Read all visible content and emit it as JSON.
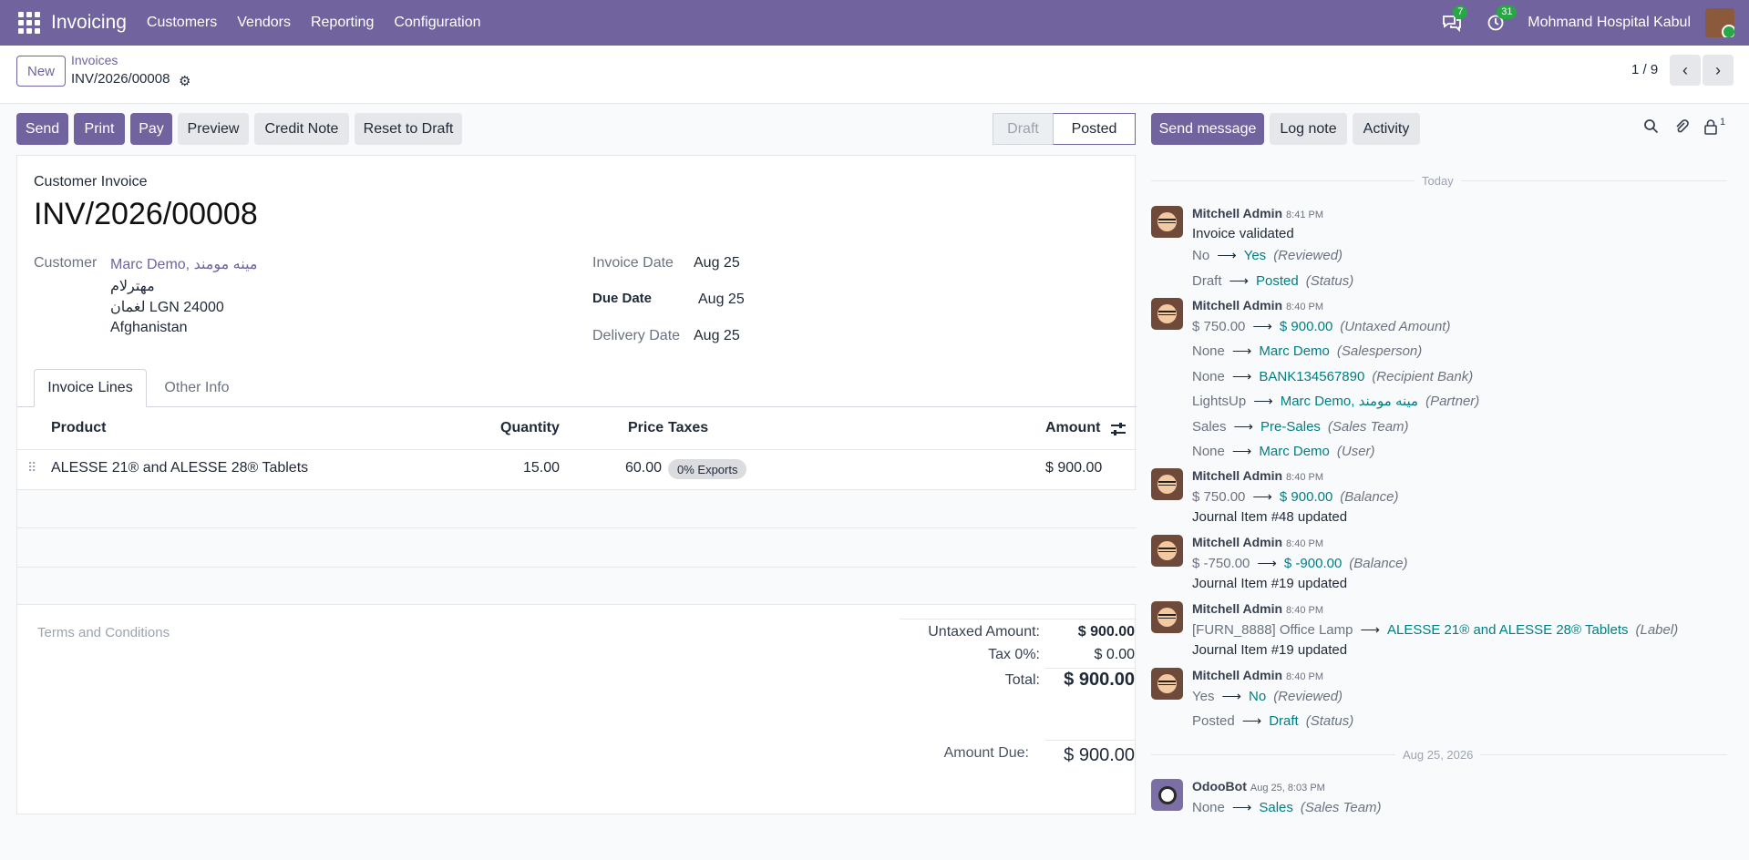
{
  "nav": {
    "app": "Invoicing",
    "menus": [
      "Customers",
      "Vendors",
      "Reporting",
      "Configuration"
    ],
    "messages_badge": "7",
    "activities_badge": "31",
    "company": "Mohmand Hospital Kabul"
  },
  "control": {
    "new_label": "New",
    "breadcrumb_parent": "Invoices",
    "breadcrumb_current": "INV/2026/00008",
    "pager": "1 / 9"
  },
  "actions": {
    "send": "Send",
    "print": "Print",
    "pay": "Pay",
    "preview": "Preview",
    "credit_note": "Credit Note",
    "reset": "Reset to Draft",
    "status_draft": "Draft",
    "status_posted": "Posted"
  },
  "invoice": {
    "type": "Customer Invoice",
    "number": "INV/2026/00008",
    "customer_label": "Customer",
    "customer_name": "Marc Demo, مينه مومند",
    "address_line1": "مهترلام",
    "address_line2": "لغمان LGN 24000",
    "address_line3": "Afghanistan",
    "invoice_date_label": "Invoice Date",
    "invoice_date": "Aug 25",
    "due_date_label": "Due Date",
    "due_date": "Aug 25",
    "delivery_date_label": "Delivery Date",
    "delivery_date": "Aug 25",
    "tabs": [
      "Invoice Lines",
      "Other Info"
    ],
    "columns": {
      "product": "Product",
      "quantity": "Quantity",
      "price": "Price",
      "taxes": "Taxes",
      "amount": "Amount"
    },
    "line": {
      "product": "ALESSE 21® and ALESSE 28® Tablets",
      "quantity": "15.00",
      "price": "60.00",
      "tax": "0% Exports",
      "amount": "$ 900.00"
    },
    "terms_placeholder": "Terms and Conditions",
    "totals": {
      "untaxed_label": "Untaxed Amount:",
      "untaxed": "$ 900.00",
      "tax_label": "Tax 0%:",
      "tax": "$ 0.00",
      "total_label": "Total:",
      "total": "$ 900.00",
      "due_label": "Amount Due:",
      "due": "$ 900.00"
    }
  },
  "chatter": {
    "send_message": "Send message",
    "log_note": "Log note",
    "activity": "Activity",
    "followers_count": "1",
    "today": "Today",
    "date_sep": "Aug 25, 2026",
    "messages": [
      {
        "author": "Mitchell Admin",
        "time": "8:41 PM",
        "body": "Invoice validated",
        "changes": [
          {
            "old": "No",
            "new": "Yes",
            "field": "(Reviewed)"
          },
          {
            "old": "Draft",
            "new": "Posted",
            "field": "(Status)"
          }
        ]
      },
      {
        "author": "Mitchell Admin",
        "time": "8:40 PM",
        "changes": [
          {
            "old": "$ 750.00",
            "new": "$ 900.00",
            "field": "(Untaxed Amount)"
          },
          {
            "old": "None",
            "new": "Marc Demo",
            "field": "(Salesperson)"
          },
          {
            "old": "None",
            "new": "BANK134567890",
            "field": "(Recipient Bank)"
          },
          {
            "old": "LightsUp",
            "new": "Marc Demo, مينه مومند",
            "field": "(Partner)"
          },
          {
            "old": "Sales",
            "new": "Pre-Sales",
            "field": "(Sales Team)"
          },
          {
            "old": "None",
            "new": "Marc Demo",
            "field": "(User)"
          }
        ]
      },
      {
        "author": "Mitchell Admin",
        "time": "8:40 PM",
        "changes": [
          {
            "old": "$ 750.00",
            "new": "$ 900.00",
            "field": "(Balance)"
          }
        ],
        "footer": "Journal Item #48 updated"
      },
      {
        "author": "Mitchell Admin",
        "time": "8:40 PM",
        "changes": [
          {
            "old": "$ -750.00",
            "new": "$ -900.00",
            "field": "(Balance)"
          }
        ],
        "footer": "Journal Item #19 updated"
      },
      {
        "author": "Mitchell Admin",
        "time": "8:40 PM",
        "changes": [
          {
            "old": "[FURN_8888] Office Lamp",
            "new": "ALESSE 21® and ALESSE 28® Tablets",
            "field": "(Label)"
          }
        ],
        "footer": "Journal Item #19 updated"
      },
      {
        "author": "Mitchell Admin",
        "time": "8:40 PM",
        "changes": [
          {
            "old": "Yes",
            "new": "No",
            "field": "(Reviewed)"
          },
          {
            "old": "Posted",
            "new": "Draft",
            "field": "(Status)"
          }
        ]
      },
      {
        "author": "OdooBot",
        "time": "Aug 25, 8:03 PM",
        "changes": [
          {
            "old": "None",
            "new": "Sales",
            "field": "(Sales Team)"
          }
        ]
      }
    ]
  },
  "colors": {
    "brand": "#71639e",
    "link_teal": "#017e84",
    "badge": "#28a745"
  }
}
